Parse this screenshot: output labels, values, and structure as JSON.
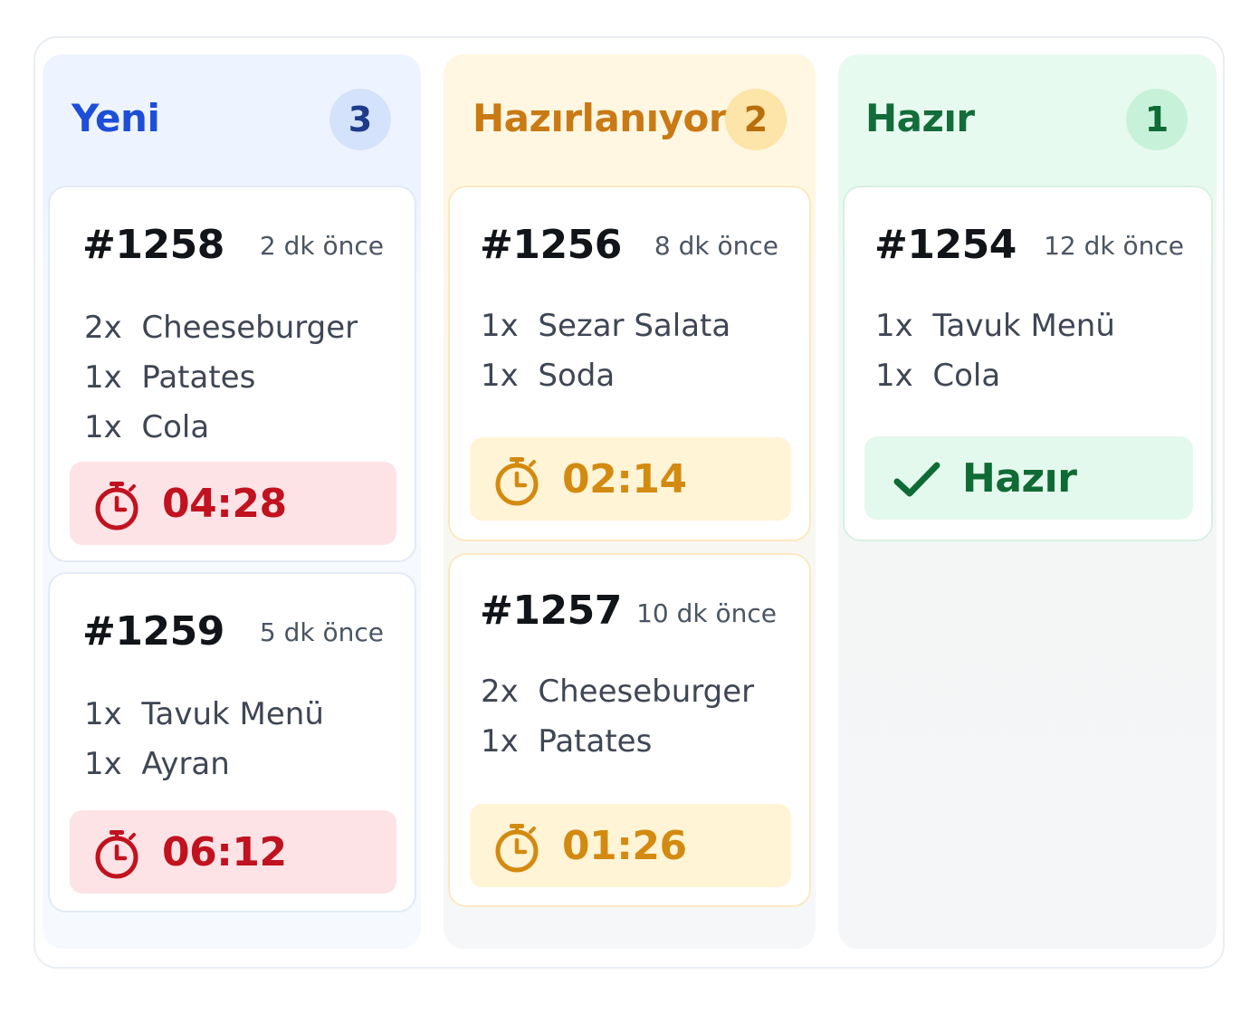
{
  "columns": [
    {
      "title": "Yeni",
      "count": "3",
      "orders": [
        {
          "number": "#1258",
          "ago": "2 dk önce",
          "items": [
            "2x  Cheeseburger",
            "1x  Patates",
            "1x  Cola"
          ],
          "timer": "04:28"
        },
        {
          "number": "#1259",
          "ago": "5 dk önce",
          "items": [
            "1x  Tavuk Menü",
            "1x  Ayran"
          ],
          "timer": "06:12"
        }
      ]
    },
    {
      "title": "Hazırlanıyor",
      "count": "2",
      "orders": [
        {
          "number": "#1256",
          "ago": "8 dk önce",
          "items": [
            "1x  Sezar Salata",
            "1x  Soda"
          ],
          "timer": "02:14"
        },
        {
          "number": "#1257",
          "ago": "10 dk önce",
          "items": [
            "2x  Cheeseburger",
            "1x  Patates"
          ],
          "timer": "01:26"
        }
      ]
    },
    {
      "title": "Hazır",
      "count": "1",
      "orders": [
        {
          "number": "#1254",
          "ago": "12 dk önce",
          "items": [
            "1x  Tavuk Menü",
            "1x  Cola"
          ],
          "status": "Hazır"
        }
      ]
    }
  ],
  "icons": {
    "timer": "stopwatch-icon",
    "done": "checkmark-icon"
  },
  "colors": {
    "new": "#1d4ed8",
    "preparing": "#c97a14",
    "ready": "#136d3a",
    "late": "#c1121f"
  }
}
